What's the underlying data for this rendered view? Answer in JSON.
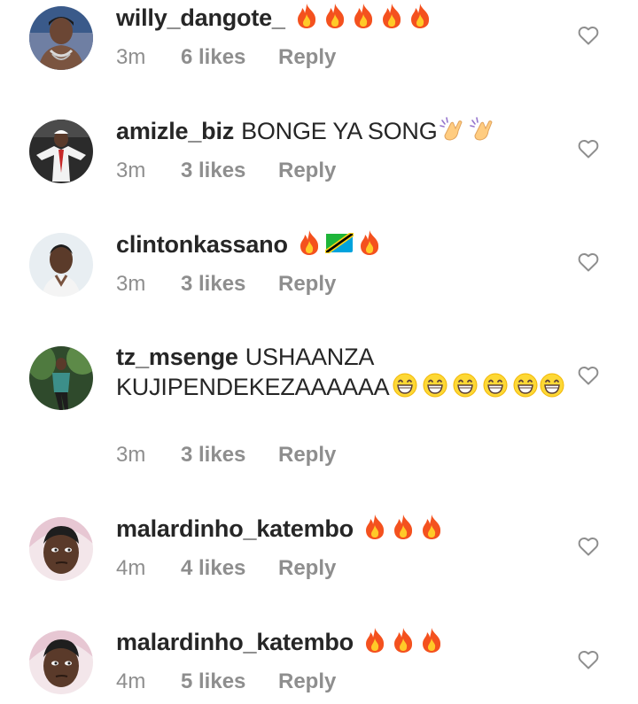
{
  "comments": [
    {
      "username": "willy_dangote_",
      "message": "",
      "emojis": [
        "fire-emoji",
        "fire-emoji",
        "fire-emoji",
        "fire-emoji",
        "fire-emoji"
      ],
      "time": "3m",
      "likes": "6 likes",
      "reply": "Reply"
    },
    {
      "username": "amizle_biz",
      "message": "BONGE YA SONG",
      "emojis": [
        "clapping-hands-emoji",
        "clapping-hands-emoji"
      ],
      "time": "3m",
      "likes": "3 likes",
      "reply": "Reply"
    },
    {
      "username": "clintonkassano",
      "message": "",
      "emojis": [
        "fire-emoji",
        "tanzania-flag-emoji",
        "fire-emoji"
      ],
      "time": "3m",
      "likes": "3 likes",
      "reply": "Reply"
    },
    {
      "username": "tz_msenge",
      "message": "USHAANZA KUJIPENDEKEZAAAAAA",
      "emojis": [
        "grinning-emoji",
        "grinning-emoji",
        "grinning-emoji",
        "grinning-emoji",
        "grinning-emoji",
        "grinning-emoji"
      ],
      "time": "3m",
      "likes": "3 likes",
      "reply": "Reply"
    },
    {
      "username": "malardinho_katembo",
      "message": "",
      "emojis": [
        "fire-emoji",
        "fire-emoji",
        "fire-emoji"
      ],
      "time": "4m",
      "likes": "4 likes",
      "reply": "Reply"
    },
    {
      "username": "malardinho_katembo",
      "message": "",
      "emojis": [
        "fire-emoji",
        "fire-emoji",
        "fire-emoji"
      ],
      "time": "4m",
      "likes": "5 likes",
      "reply": "Reply"
    }
  ],
  "colors": {
    "text": "#262626",
    "meta": "#8e8e8e",
    "heart_outline": "#8e8e8e",
    "fire_outer": "#f4511e",
    "fire_inner": "#ffca28",
    "clap": "#ffcc80",
    "grin_face": "#fdd835",
    "flag_green": "#1eb53a",
    "flag_blue": "#00a3dd",
    "flag_black": "#000000",
    "flag_yellow": "#fcd116"
  }
}
